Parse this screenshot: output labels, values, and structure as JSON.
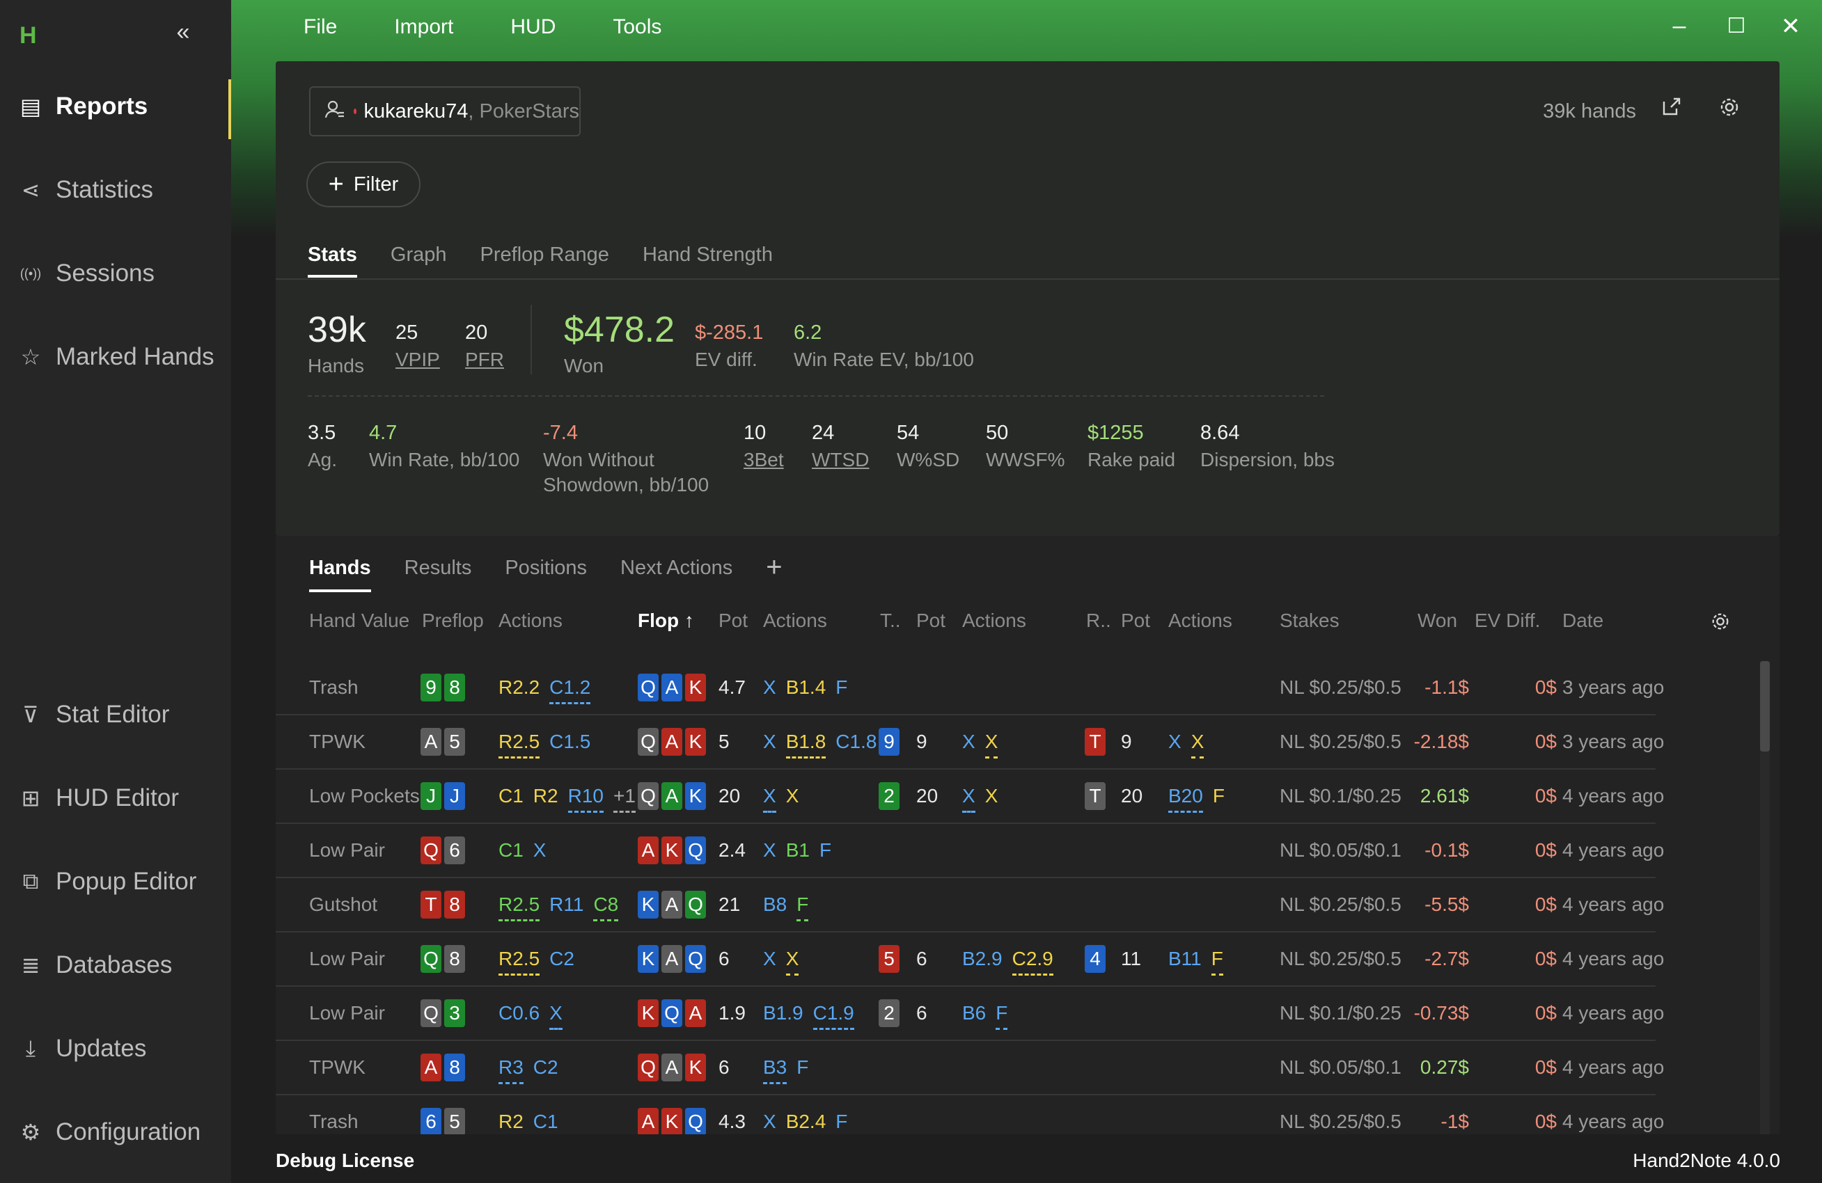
{
  "app": {
    "logo": "H",
    "collapse_glyph": "«",
    "version": "Hand2Note 4.0.0",
    "license": "Debug License"
  },
  "menu": [
    "File",
    "Import",
    "HUD",
    "Tools"
  ],
  "window_controls": {
    "minimize": "–",
    "maximize": "☐",
    "close": "✕"
  },
  "sidebar": {
    "items": [
      {
        "label": "Reports",
        "icon": "report-icon",
        "glyph": "▤",
        "active": true
      },
      {
        "label": "Statistics",
        "icon": "share-nodes-icon",
        "glyph": "⋖"
      },
      {
        "label": "Sessions",
        "icon": "broadcast-icon",
        "glyph": "((•))"
      },
      {
        "label": "Marked Hands",
        "icon": "star-list-icon",
        "glyph": "☆"
      },
      {
        "label": "Stat Editor",
        "icon": "filter-icon",
        "glyph": "⊽"
      },
      {
        "label": "HUD Editor",
        "icon": "layout-icon",
        "glyph": "⊞"
      },
      {
        "label": "Popup Editor",
        "icon": "windows-icon",
        "glyph": "⧉"
      },
      {
        "label": "Databases",
        "icon": "database-icon",
        "glyph": "≣"
      },
      {
        "label": "Updates",
        "icon": "download-icon",
        "glyph": "⤓"
      },
      {
        "label": "Configuration",
        "icon": "gear-icon",
        "glyph": "⚙"
      }
    ]
  },
  "player": {
    "name": "kukareku74",
    "separator": ",",
    "site": "PokerStars"
  },
  "header": {
    "hands_count": "39k hands",
    "filter_label": "Filter"
  },
  "report_tabs": [
    {
      "label": "Stats",
      "active": true
    },
    {
      "label": "Graph"
    },
    {
      "label": "Preflop Range"
    },
    {
      "label": "Hand Strength"
    }
  ],
  "stats_top": [
    {
      "value": "39k",
      "label": "Hands"
    },
    {
      "value": "25",
      "label": "VPIP"
    },
    {
      "value": "20",
      "label": "PFR"
    },
    {
      "value": "$478.2",
      "label": "Won"
    },
    {
      "value": "$-285.1",
      "label": "EV diff."
    },
    {
      "value": "6.2",
      "label": "Win Rate EV, bb/100"
    }
  ],
  "stats_bottom": [
    {
      "value": "3.5",
      "label": "Ag."
    },
    {
      "value": "4.7",
      "label": "Win Rate, bb/100"
    },
    {
      "value": "-7.4",
      "label": "Won Without",
      "label2": "Showdown, bb/100"
    },
    {
      "value": "10",
      "label": "3Bet"
    },
    {
      "value": "24",
      "label": "WTSD"
    },
    {
      "value": "54",
      "label": "W%SD"
    },
    {
      "value": "50",
      "label": "WWSF%"
    },
    {
      "value": "$1255",
      "label": "Rake paid"
    },
    {
      "value": "8.64",
      "label": "Dispersion, bbs"
    }
  ],
  "hands_tabs": [
    {
      "label": "Hands",
      "active": true
    },
    {
      "label": "Results"
    },
    {
      "label": "Positions"
    },
    {
      "label": "Next Actions"
    }
  ],
  "hands_tab_add": "+",
  "columns": [
    "Hand Value",
    "Preflop",
    "Actions",
    "Flop ↑",
    "Pot",
    "Actions",
    "T..",
    "Pot",
    "Actions",
    "R..",
    "Pot",
    "Actions",
    "Stakes",
    "Won",
    "EV Diff.",
    "Date"
  ],
  "colors": {
    "accent_green": "#3f9f46",
    "positive": "#a5de7a",
    "negative": "#ef8f7a",
    "active_marker": "#e7d45a"
  },
  "hands": [
    {
      "hv": "Trash",
      "pre": [
        [
          "9",
          "g"
        ],
        [
          "8",
          "g"
        ]
      ],
      "pact": [
        [
          "R2.2",
          "y",
          ""
        ],
        [
          "C1.2",
          "b",
          "b"
        ]
      ],
      "flop": [
        [
          "Q",
          "b"
        ],
        [
          "A",
          "b"
        ],
        [
          "K",
          "r"
        ]
      ],
      "fpot": "4.7",
      "fact": [
        [
          "X",
          "b",
          ""
        ],
        [
          "B1.4",
          "y",
          ""
        ],
        [
          "F",
          "b",
          ""
        ]
      ],
      "turn": [],
      "tpot": "",
      "tact": [],
      "river": [],
      "rpot": "",
      "ract": [],
      "stakes": "NL $0.25/$0.5",
      "won": "-1.1$",
      "ev": "0$",
      "date": "3 years ago"
    },
    {
      "hv": "TPWK",
      "pre": [
        [
          "A",
          "x"
        ],
        [
          "5",
          "x"
        ]
      ],
      "pact": [
        [
          "R2.5",
          "y",
          "y"
        ],
        [
          "C1.5",
          "b",
          ""
        ]
      ],
      "flop": [
        [
          "Q",
          "x"
        ],
        [
          "A",
          "r"
        ],
        [
          "K",
          "r"
        ]
      ],
      "fpot": "5",
      "fact": [
        [
          "X",
          "b",
          ""
        ],
        [
          "B1.8",
          "y",
          "y"
        ],
        [
          "C1.8",
          "b",
          ""
        ]
      ],
      "turn": [
        [
          "9",
          "b"
        ]
      ],
      "tpot": "9",
      "tact": [
        [
          "X",
          "b",
          ""
        ],
        [
          "X",
          "y",
          "y"
        ]
      ],
      "river": [
        [
          "T",
          "r"
        ]
      ],
      "rpot": "9",
      "ract": [
        [
          "X",
          "b",
          ""
        ],
        [
          "X",
          "y",
          "y"
        ]
      ],
      "stakes": "NL $0.25/$0.5",
      "won": "-2.18$",
      "ev": "0$",
      "date": "3 years ago"
    },
    {
      "hv": "Low Pockets",
      "pre": [
        [
          "J",
          "g"
        ],
        [
          "J",
          "b"
        ]
      ],
      "pact": [
        [
          "C1",
          "y",
          ""
        ],
        [
          "R2",
          "y",
          ""
        ],
        [
          "R10",
          "b",
          "b"
        ],
        [
          "+1",
          "gr",
          "gr"
        ]
      ],
      "flop": [
        [
          "Q",
          "x"
        ],
        [
          "A",
          "g"
        ],
        [
          "K",
          "b"
        ]
      ],
      "fpot": "20",
      "fact": [
        [
          "X",
          "b",
          "b"
        ],
        [
          "X",
          "y",
          ""
        ]
      ],
      "turn": [
        [
          "2",
          "g"
        ]
      ],
      "tpot": "20",
      "tact": [
        [
          "X",
          "b",
          "b"
        ],
        [
          "X",
          "y",
          ""
        ]
      ],
      "river": [
        [
          "T",
          "x"
        ]
      ],
      "rpot": "20",
      "ract": [
        [
          "B20",
          "b",
          "b"
        ],
        [
          "F",
          "y",
          ""
        ]
      ],
      "stakes": "NL $0.1/$0.25",
      "won": "2.61$",
      "ev": "0$",
      "date": "4 years ago"
    },
    {
      "hv": "Low Pair",
      "pre": [
        [
          "Q",
          "r"
        ],
        [
          "6",
          "x"
        ]
      ],
      "pact": [
        [
          "C1",
          "g",
          ""
        ],
        [
          "X",
          "b",
          ""
        ]
      ],
      "flop": [
        [
          "A",
          "r"
        ],
        [
          "K",
          "r"
        ],
        [
          "Q",
          "b"
        ]
      ],
      "fpot": "2.4",
      "fact": [
        [
          "X",
          "b",
          ""
        ],
        [
          "B1",
          "g",
          ""
        ],
        [
          "F",
          "b",
          ""
        ]
      ],
      "turn": [],
      "tpot": "",
      "tact": [],
      "river": [],
      "rpot": "",
      "ract": [],
      "stakes": "NL $0.05/$0.1",
      "won": "-0.1$",
      "ev": "0$",
      "date": "4 years ago"
    },
    {
      "hv": "Gutshot",
      "pre": [
        [
          "T",
          "r"
        ],
        [
          "8",
          "r"
        ]
      ],
      "pact": [
        [
          "R2.5",
          "g",
          "g"
        ],
        [
          "R11",
          "b",
          ""
        ],
        [
          "C8",
          "g",
          "g"
        ]
      ],
      "flop": [
        [
          "K",
          "b"
        ],
        [
          "A",
          "x"
        ],
        [
          "Q",
          "g"
        ]
      ],
      "fpot": "21",
      "fact": [
        [
          "B8",
          "b",
          ""
        ],
        [
          "F",
          "g",
          "g"
        ]
      ],
      "turn": [],
      "tpot": "",
      "tact": [],
      "river": [],
      "rpot": "",
      "ract": [],
      "stakes": "NL $0.25/$0.5",
      "won": "-5.5$",
      "ev": "0$",
      "date": "4 years ago"
    },
    {
      "hv": "Low Pair",
      "pre": [
        [
          "Q",
          "g"
        ],
        [
          "8",
          "x"
        ]
      ],
      "pact": [
        [
          "R2.5",
          "y",
          "y"
        ],
        [
          "C2",
          "b",
          ""
        ]
      ],
      "flop": [
        [
          "K",
          "b"
        ],
        [
          "A",
          "x"
        ],
        [
          "Q",
          "b"
        ]
      ],
      "fpot": "6",
      "fact": [
        [
          "X",
          "b",
          ""
        ],
        [
          "X",
          "y",
          "y"
        ]
      ],
      "turn": [
        [
          "5",
          "r"
        ]
      ],
      "tpot": "6",
      "tact": [
        [
          "B2.9",
          "b",
          ""
        ],
        [
          "C2.9",
          "y",
          "y"
        ]
      ],
      "river": [
        [
          "4",
          "b"
        ]
      ],
      "rpot": "11",
      "ract": [
        [
          "B11",
          "b",
          ""
        ],
        [
          "F",
          "y",
          "y"
        ]
      ],
      "stakes": "NL $0.25/$0.5",
      "won": "-2.7$",
      "ev": "0$",
      "date": "4 years ago"
    },
    {
      "hv": "Low Pair",
      "pre": [
        [
          "Q",
          "x"
        ],
        [
          "3",
          "g"
        ]
      ],
      "pact": [
        [
          "C0.6",
          "b",
          ""
        ],
        [
          "X",
          "b",
          "b"
        ]
      ],
      "flop": [
        [
          "K",
          "r"
        ],
        [
          "Q",
          "b"
        ],
        [
          "A",
          "r"
        ]
      ],
      "fpot": "1.9",
      "fact": [
        [
          "B1.9",
          "b",
          ""
        ],
        [
          "C1.9",
          "b",
          "b"
        ]
      ],
      "turn": [
        [
          "2",
          "x"
        ]
      ],
      "tpot": "6",
      "tact": [
        [
          "B6",
          "b",
          ""
        ],
        [
          "F",
          "b",
          "b"
        ]
      ],
      "river": [],
      "rpot": "",
      "ract": [],
      "stakes": "NL $0.1/$0.25",
      "won": "-0.73$",
      "ev": "0$",
      "date": "4 years ago"
    },
    {
      "hv": "TPWK",
      "pre": [
        [
          "A",
          "r"
        ],
        [
          "8",
          "b"
        ]
      ],
      "pact": [
        [
          "R3",
          "b",
          "b"
        ],
        [
          "C2",
          "b",
          ""
        ]
      ],
      "flop": [
        [
          "Q",
          "r"
        ],
        [
          "A",
          "x"
        ],
        [
          "K",
          "r"
        ]
      ],
      "fpot": "6",
      "fact": [
        [
          "B3",
          "b",
          "b"
        ],
        [
          "F",
          "b",
          ""
        ]
      ],
      "turn": [],
      "tpot": "",
      "tact": [],
      "river": [],
      "rpot": "",
      "ract": [],
      "stakes": "NL $0.05/$0.1",
      "won": "0.27$",
      "ev": "0$",
      "date": "4 years ago"
    },
    {
      "hv": "Trash",
      "pre": [
        [
          "6",
          "b"
        ],
        [
          "5",
          "x"
        ]
      ],
      "pact": [
        [
          "R2",
          "y",
          ""
        ],
        [
          "C1",
          "b",
          ""
        ]
      ],
      "flop": [
        [
          "A",
          "r"
        ],
        [
          "K",
          "r"
        ],
        [
          "Q",
          "b"
        ]
      ],
      "fpot": "4.3",
      "fact": [
        [
          "X",
          "b",
          ""
        ],
        [
          "B2.4",
          "y",
          ""
        ],
        [
          "F",
          "b",
          ""
        ]
      ],
      "turn": [],
      "tpot": "",
      "tact": [],
      "river": [],
      "rpot": "",
      "ract": [],
      "stakes": "NL $0.25/$0.5",
      "won": "-1$",
      "ev": "0$",
      "date": "4 years ago"
    }
  ]
}
